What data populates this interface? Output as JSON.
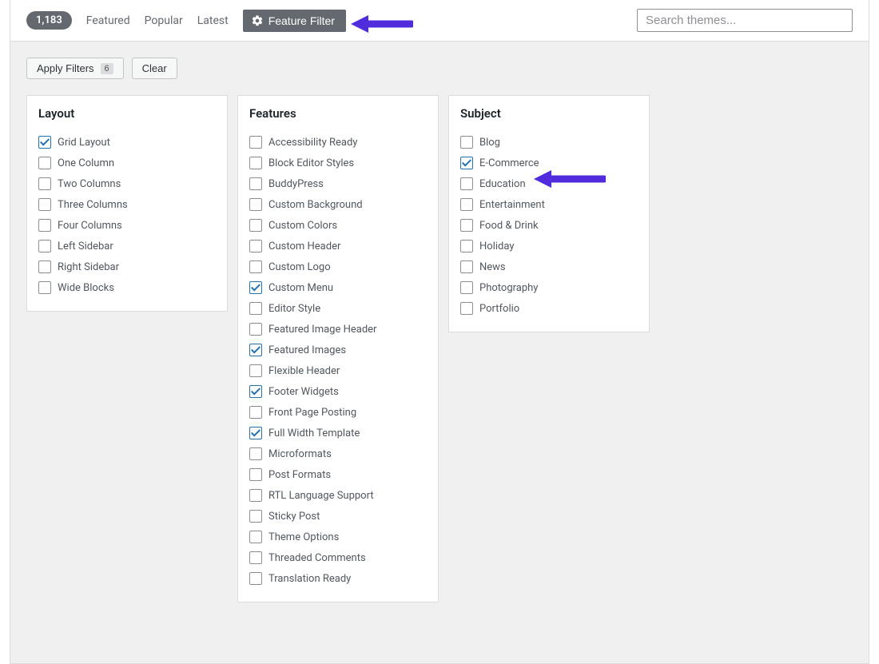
{
  "nav": {
    "count": "1,183",
    "featured": "Featured",
    "popular": "Popular",
    "latest": "Latest",
    "feature_filter": "Feature Filter",
    "search_placeholder": "Search themes..."
  },
  "actions": {
    "apply": "Apply Filters",
    "apply_count": "6",
    "clear": "Clear"
  },
  "layout": {
    "title": "Layout",
    "items": [
      {
        "label": "Grid Layout",
        "checked": true
      },
      {
        "label": "One Column",
        "checked": false
      },
      {
        "label": "Two Columns",
        "checked": false
      },
      {
        "label": "Three Columns",
        "checked": false
      },
      {
        "label": "Four Columns",
        "checked": false
      },
      {
        "label": "Left Sidebar",
        "checked": false
      },
      {
        "label": "Right Sidebar",
        "checked": false
      },
      {
        "label": "Wide Blocks",
        "checked": false
      }
    ]
  },
  "features": {
    "title": "Features",
    "items": [
      {
        "label": "Accessibility Ready",
        "checked": false
      },
      {
        "label": "Block Editor Styles",
        "checked": false
      },
      {
        "label": "BuddyPress",
        "checked": false
      },
      {
        "label": "Custom Background",
        "checked": false
      },
      {
        "label": "Custom Colors",
        "checked": false
      },
      {
        "label": "Custom Header",
        "checked": false
      },
      {
        "label": "Custom Logo",
        "checked": false
      },
      {
        "label": "Custom Menu",
        "checked": true
      },
      {
        "label": "Editor Style",
        "checked": false
      },
      {
        "label": "Featured Image Header",
        "checked": false
      },
      {
        "label": "Featured Images",
        "checked": true
      },
      {
        "label": "Flexible Header",
        "checked": false
      },
      {
        "label": "Footer Widgets",
        "checked": true
      },
      {
        "label": "Front Page Posting",
        "checked": false
      },
      {
        "label": "Full Width Template",
        "checked": true
      },
      {
        "label": "Microformats",
        "checked": false
      },
      {
        "label": "Post Formats",
        "checked": false
      },
      {
        "label": "RTL Language Support",
        "checked": false
      },
      {
        "label": "Sticky Post",
        "checked": false
      },
      {
        "label": "Theme Options",
        "checked": false
      },
      {
        "label": "Threaded Comments",
        "checked": false
      },
      {
        "label": "Translation Ready",
        "checked": false
      }
    ]
  },
  "subject": {
    "title": "Subject",
    "items": [
      {
        "label": "Blog",
        "checked": false
      },
      {
        "label": "E-Commerce",
        "checked": true
      },
      {
        "label": "Education",
        "checked": false
      },
      {
        "label": "Entertainment",
        "checked": false
      },
      {
        "label": "Food & Drink",
        "checked": false
      },
      {
        "label": "Holiday",
        "checked": false
      },
      {
        "label": "News",
        "checked": false
      },
      {
        "label": "Photography",
        "checked": false
      },
      {
        "label": "Portfolio",
        "checked": false
      }
    ]
  },
  "arrow_color": "#502cdc"
}
